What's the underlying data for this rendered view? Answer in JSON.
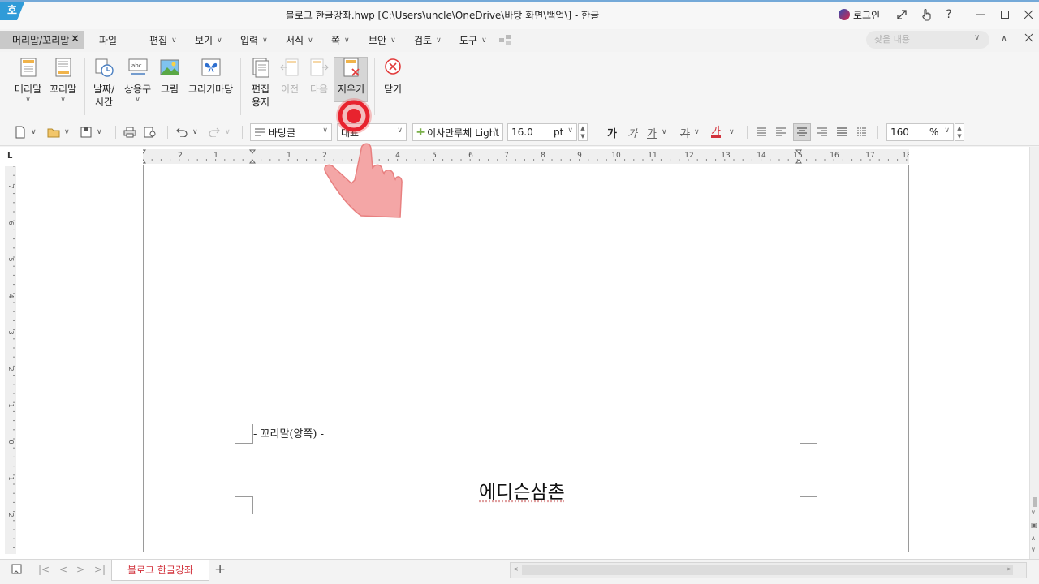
{
  "window": {
    "logo": "호",
    "title": "블로그 한글강좌.hwp [C:\\Users\\uncle\\OneDrive\\바탕 화면\\백업\\] - 한글",
    "login": "로그인",
    "help": "?"
  },
  "menu": {
    "context_tab": "머리말/꼬리말",
    "context_close": "✕",
    "items": [
      {
        "label": "파일",
        "dropdown": false
      },
      {
        "label": "편집",
        "dropdown": true
      },
      {
        "label": "보기",
        "dropdown": true
      },
      {
        "label": "입력",
        "dropdown": true
      },
      {
        "label": "서식",
        "dropdown": true
      },
      {
        "label": "쪽",
        "dropdown": true
      },
      {
        "label": "보안",
        "dropdown": true
      },
      {
        "label": "검토",
        "dropdown": true
      },
      {
        "label": "도구",
        "dropdown": true
      }
    ],
    "search_placeholder": "찾을 내용"
  },
  "ribbon": {
    "header": "머리말",
    "footer": "꼬리말",
    "date_time_1": "날짜/",
    "date_time_2": "시간",
    "common_phrase": "상용구",
    "picture": "그림",
    "drawing": "그리기마당",
    "edit_page_1": "편집",
    "edit_page_2": "용지",
    "previous": "이전",
    "next": "다음",
    "delete": "지우기",
    "close": "닫기"
  },
  "format": {
    "style": "바탕글",
    "lang": "대표",
    "font": "이사만루체 Light",
    "size": "16.0",
    "size_unit": "pt",
    "bold": "가",
    "italic": "가",
    "underline": "가",
    "strike": "가",
    "font_color": "가",
    "zoom": "160",
    "zoom_unit": "%"
  },
  "ruler": {
    "h_labels": [
      "2",
      "1",
      "1",
      "2",
      "3",
      "4",
      "5",
      "6",
      "7",
      "8",
      "9",
      "10",
      "11",
      "12",
      "13",
      "14",
      "15",
      "16",
      "17",
      "18"
    ],
    "v_labels": [
      "7",
      "6",
      "5",
      "4",
      "3",
      "2",
      "1",
      "0",
      "1",
      "2"
    ],
    "corner": "L"
  },
  "document": {
    "footer_label": "- 꼬리말(양쪽) -",
    "footer_text": "에디슨삼촌"
  },
  "tabs": {
    "doc_tab": "블로그 한글강좌",
    "add": "+",
    "nav": [
      "|<",
      "<",
      ">",
      ">|"
    ]
  },
  "colors": {
    "accent": "#2f9bd8",
    "tab_red": "#d2323c",
    "touch_red": "#e8232e"
  }
}
